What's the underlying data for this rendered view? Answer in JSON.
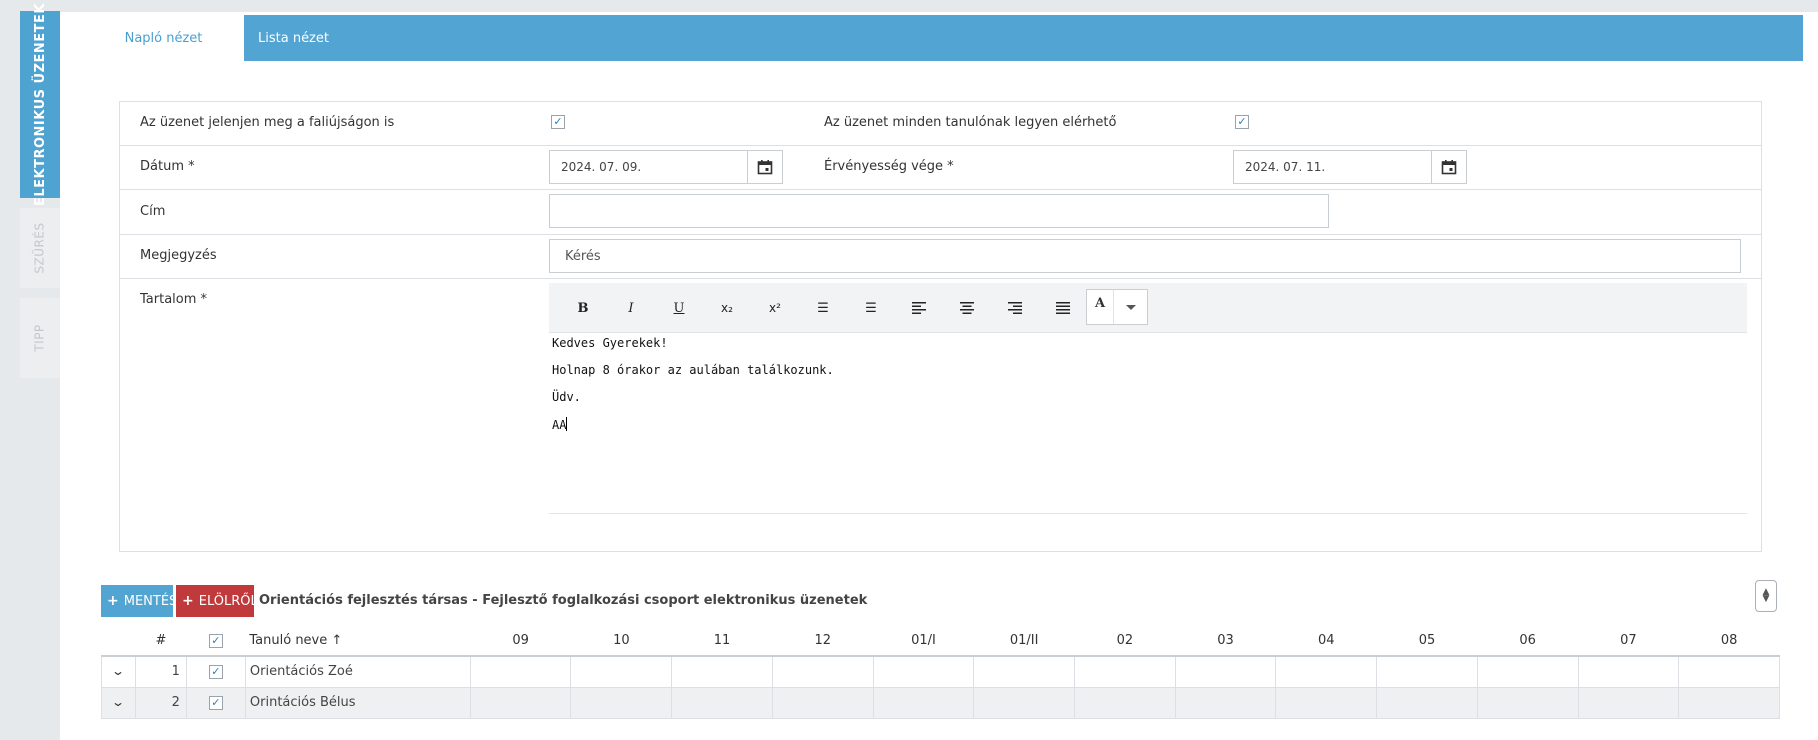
{
  "side_tabs": {
    "messages": "ELEKTRONIKUS ÜZENETEK",
    "filter": "SZŰRÉS",
    "tip": "TIPP"
  },
  "tabs": {
    "log_view": "Napló nézet",
    "list_view": "Lista nézet"
  },
  "form": {
    "wall_label": "Az üzenet jelenjen meg a faliújságon is",
    "wall_checked": "✓",
    "all_students_label": "Az üzenet minden tanulónak legyen elérhető",
    "all_students_checked": "✓",
    "date_label": "Dátum *",
    "date_value": "2024. 07. 09.",
    "validity_label": "Érvényesség vége *",
    "validity_value": "2024. 07. 11.",
    "title_label": "Cím",
    "title_value": "",
    "note_label": "Megjegyzés",
    "note_value": "Kérés",
    "content_label": "Tartalom *"
  },
  "toolbar": {
    "bold": "B",
    "italic": "I",
    "underline": "U",
    "subscript": "x₂",
    "superscript": "x²",
    "ordered_list": "☰",
    "unordered_list": "☰",
    "color": "A"
  },
  "editor": {
    "line1": "Kedves Gyerekek!",
    "line2": "Holnap 8 órakor az aulában találkozunk.",
    "line3": "Üdv.",
    "line4": "AA"
  },
  "actions": {
    "save": "MENTÉS",
    "reset": "ELÖLRŐL",
    "plus": "+",
    "grid_title": "Orientációs fejlesztés társas - Fejlesztő foglalkozási csoport elektronikus üzenetek"
  },
  "grid": {
    "col_index": "#",
    "col_select": "✓",
    "col_name": "Tanuló neve ↑",
    "columns": [
      "09",
      "10",
      "11",
      "12",
      "01/I",
      "01/II",
      "02",
      "03",
      "04",
      "05",
      "06",
      "07",
      "08"
    ],
    "rows": [
      {
        "index": "1",
        "checked": "✓",
        "name": "Orientációs Zoé"
      },
      {
        "index": "2",
        "checked": "✓",
        "name": "Orintációs Bélus"
      }
    ]
  }
}
